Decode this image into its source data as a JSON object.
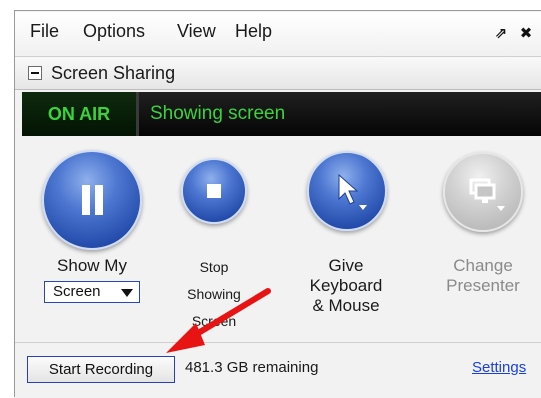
{
  "menu": {
    "items": [
      "File",
      "Options",
      "View",
      "Help"
    ],
    "popout_icon": "popout-icon",
    "close_icon": "close-icon"
  },
  "section": {
    "title": "Screen Sharing",
    "collapse_icon": "minus-icon"
  },
  "status": {
    "badge": "ON AIR",
    "text": "Showing screen",
    "accent_color": "#3cd23c"
  },
  "controls": {
    "show_my": {
      "label": "Show My",
      "dropdown_value": "Screen",
      "icon": "pause-icon"
    },
    "stop_showing": {
      "label_lines": [
        "Stop",
        "Showing",
        "Screen"
      ],
      "icon": "stop-icon"
    },
    "give_keyboard": {
      "label_lines": [
        "Give",
        "Keyboard",
        "& Mouse"
      ],
      "icon": "cursor-icon"
    },
    "change_presenter": {
      "label_lines": [
        "Change",
        "Presenter"
      ],
      "icon": "monitor-icon",
      "disabled": true
    }
  },
  "footer": {
    "record_button": "Start Recording",
    "remaining": "481.3 GB remaining",
    "settings_link": "Settings"
  },
  "colors": {
    "button_blue": "#2148a8",
    "annotation_arrow": "#e81414",
    "link": "#1a3fe0"
  }
}
